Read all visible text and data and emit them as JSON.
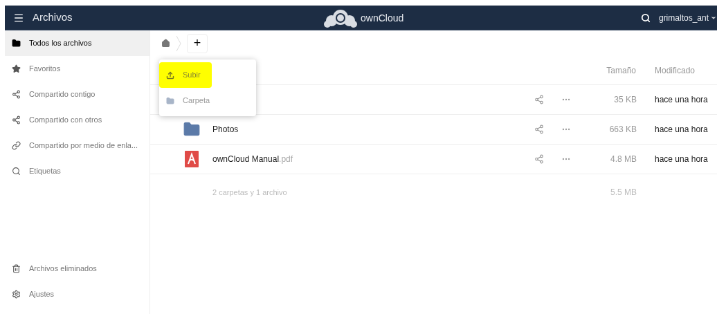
{
  "header": {
    "app_title": "Archivos",
    "brand": "ownCloud",
    "user": "grimaltos_ant"
  },
  "sidebar": {
    "items": [
      {
        "label": "Todos los archivos",
        "selected": true
      },
      {
        "label": "Favoritos",
        "selected": false
      },
      {
        "label": "Compartido contigo",
        "selected": false
      },
      {
        "label": "Compartido con otros",
        "selected": false
      },
      {
        "label": "Compartido por medio de enla...",
        "selected": false
      },
      {
        "label": "Etiquetas",
        "selected": false
      }
    ],
    "bottom_items": [
      {
        "label": "Archivos eliminados"
      },
      {
        "label": "Ajustes"
      }
    ]
  },
  "new_button": {
    "label": "+"
  },
  "new_menu": {
    "items": [
      {
        "label": "Subir",
        "highlighted": true
      },
      {
        "label": "Carpeta",
        "highlighted": false
      }
    ]
  },
  "table": {
    "columns": [
      "Tamaño",
      "Modificado"
    ],
    "rows": [
      {
        "kind": "hidden",
        "size": "35 KB",
        "modified": "hace una hora"
      },
      {
        "kind": "folder",
        "name": "Photos",
        "size": "663 KB",
        "modified": "hace una hora"
      },
      {
        "kind": "pdf",
        "name": "ownCloud Manual",
        "extension": ".pdf",
        "size": "4.8 MB",
        "modified": "hace una hora"
      }
    ],
    "summary": {
      "label": "2 carpetas y 1 archivo",
      "size": "5.5 MB"
    }
  }
}
